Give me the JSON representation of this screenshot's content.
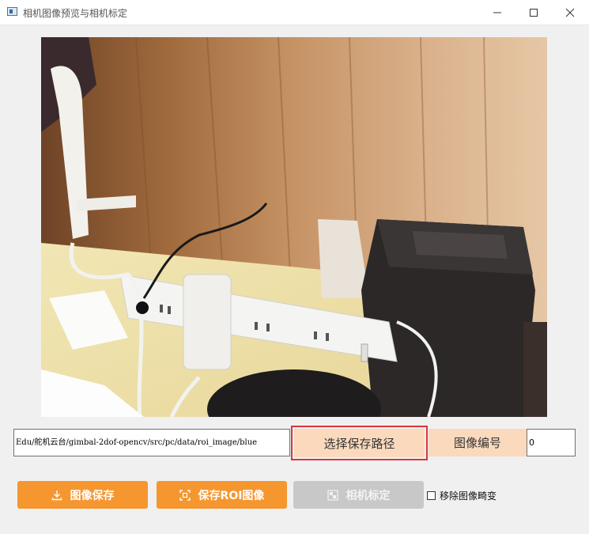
{
  "window": {
    "title": "相机图像预览与相机标定",
    "minimize_glyph": "—",
    "maximize_glyph": "☐",
    "close_glyph": "✕"
  },
  "toolbar_row": {
    "save_path_value": "Edu/舵机云台/gimbal-2dof-opencv/src/pc/data/roi_image/blue",
    "choose_path_label": "选择保存路径",
    "image_number_label": "图像编号",
    "image_number_value": "0"
  },
  "actions": {
    "save_image_label": "图像保存",
    "save_roi_label": "保存ROI图像",
    "calibrate_label": "相机标定",
    "undistort_label": "移除图像畸变",
    "undistort_checked": false
  },
  "icons": {
    "save": "download-icon",
    "roi": "crop-focus-icon",
    "calibrate": "chessboard-icon"
  },
  "colors": {
    "accent_orange": "#f5962f",
    "light_orange": "#fbd9bd",
    "highlight_border": "#d9363e",
    "disabled_grey": "#c8c8c8"
  }
}
